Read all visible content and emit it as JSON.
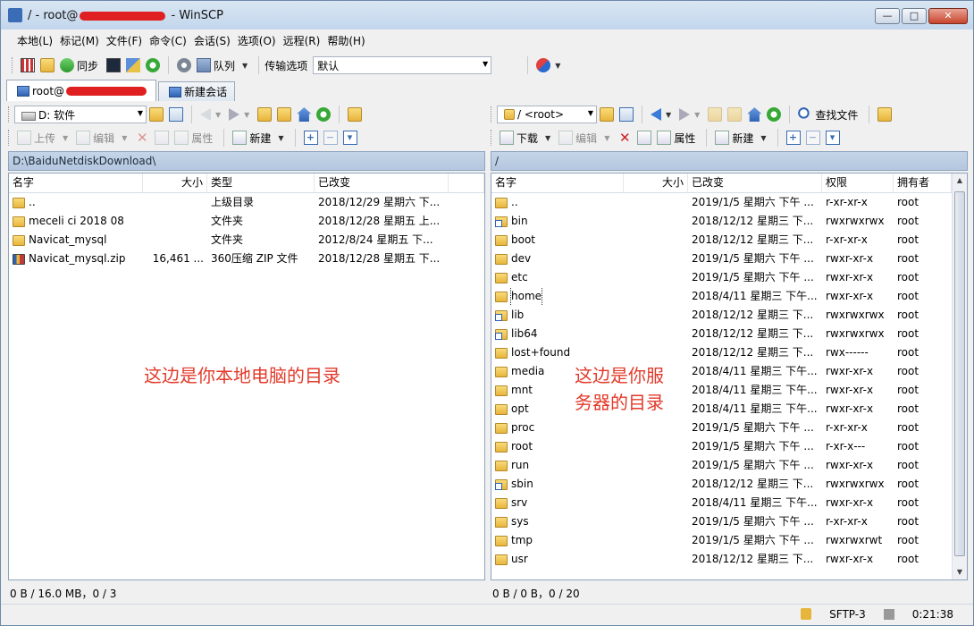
{
  "window": {
    "title_prefix": "/ - root@",
    "title_suffix": " - WinSCP",
    "min_icon": "—",
    "max_icon": "□",
    "close_icon": "✕"
  },
  "menu": [
    "本地(L)",
    "标记(M)",
    "文件(F)",
    "命令(C)",
    "会话(S)",
    "选项(O)",
    "远程(R)",
    "帮助(H)"
  ],
  "toolbar": {
    "sync_label": "同步",
    "queue_label": "队列",
    "transfer_label": "传输选项",
    "transfer_value": "默认"
  },
  "tabs": {
    "session_label": "root@",
    "new_session_label": "新建会话"
  },
  "left": {
    "drive": "D: 软件",
    "upload_label": "上传",
    "edit_label": "编辑",
    "props_label": "属性",
    "new_label": "新建",
    "path": "D:\\BaiduNetdiskDownload\\",
    "headers": [
      "名字",
      "大小",
      "类型",
      "已改变"
    ],
    "rows": [
      {
        "name": "..",
        "size": "",
        "type": "上级目录",
        "changed": "2018/12/29 星期六  下..."
      },
      {
        "name": "meceli ci 2018 08",
        "size": "",
        "type": "文件夹",
        "changed": "2018/12/28 星期五  上..."
      },
      {
        "name": "Navicat_mysql",
        "size": "",
        "type": "文件夹",
        "changed": "2012/8/24 星期五  下..."
      },
      {
        "name": "Navicat_mysql.zip",
        "size": "16,461 ...",
        "type": "360压缩 ZIP 文件",
        "changed": "2018/12/28 星期五  下..."
      }
    ],
    "annotation": "这边是你本地电脑的目录",
    "status": "0 B / 16.0 MB，0 / 3"
  },
  "right": {
    "location": "/ <root>",
    "download_label": "下载",
    "edit_label": "编辑",
    "props_label": "属性",
    "new_label": "新建",
    "find_label": "查找文件",
    "path": "/",
    "headers": [
      "名字",
      "大小",
      "已改变",
      "权限",
      "拥有者"
    ],
    "rows": [
      {
        "name": "..",
        "changed": "2019/1/5 星期六 下午 ...",
        "perm": "r-xr-xr-x",
        "owner": "root",
        "kind": "up"
      },
      {
        "name": "bin",
        "changed": "2018/12/12 星期三 下...",
        "perm": "rwxrwxrwx",
        "owner": "root",
        "kind": "link"
      },
      {
        "name": "boot",
        "changed": "2018/12/12 星期三 下...",
        "perm": "r-xr-xr-x",
        "owner": "root",
        "kind": "dir"
      },
      {
        "name": "dev",
        "changed": "2019/1/5 星期六 下午 ...",
        "perm": "rwxr-xr-x",
        "owner": "root",
        "kind": "dir"
      },
      {
        "name": "etc",
        "changed": "2019/1/5 星期六 下午 ...",
        "perm": "rwxr-xr-x",
        "owner": "root",
        "kind": "dir"
      },
      {
        "name": "home",
        "changed": "2018/4/11 星期三 下午...",
        "perm": "rwxr-xr-x",
        "owner": "root",
        "kind": "dir"
      },
      {
        "name": "lib",
        "changed": "2018/12/12 星期三 下...",
        "perm": "rwxrwxrwx",
        "owner": "root",
        "kind": "link"
      },
      {
        "name": "lib64",
        "changed": "2018/12/12 星期三 下...",
        "perm": "rwxrwxrwx",
        "owner": "root",
        "kind": "link"
      },
      {
        "name": "lost+found",
        "changed": "2018/12/12 星期三 下...",
        "perm": "rwx------",
        "owner": "root",
        "kind": "dir"
      },
      {
        "name": "media",
        "changed": "2018/4/11 星期三 下午...",
        "perm": "rwxr-xr-x",
        "owner": "root",
        "kind": "dir"
      },
      {
        "name": "mnt",
        "changed": "2018/4/11 星期三 下午...",
        "perm": "rwxr-xr-x",
        "owner": "root",
        "kind": "dir"
      },
      {
        "name": "opt",
        "changed": "2018/4/11 星期三 下午...",
        "perm": "rwxr-xr-x",
        "owner": "root",
        "kind": "dir"
      },
      {
        "name": "proc",
        "changed": "2019/1/5 星期六 下午 ...",
        "perm": "r-xr-xr-x",
        "owner": "root",
        "kind": "dir"
      },
      {
        "name": "root",
        "changed": "2019/1/5 星期六 下午 ...",
        "perm": "r-xr-x---",
        "owner": "root",
        "kind": "dir"
      },
      {
        "name": "run",
        "changed": "2019/1/5 星期六 下午 ...",
        "perm": "rwxr-xr-x",
        "owner": "root",
        "kind": "dir"
      },
      {
        "name": "sbin",
        "changed": "2018/12/12 星期三 下...",
        "perm": "rwxrwxrwx",
        "owner": "root",
        "kind": "link"
      },
      {
        "name": "srv",
        "changed": "2018/4/11 星期三 下午...",
        "perm": "rwxr-xr-x",
        "owner": "root",
        "kind": "dir"
      },
      {
        "name": "sys",
        "changed": "2019/1/5 星期六 下午 ...",
        "perm": "r-xr-xr-x",
        "owner": "root",
        "kind": "dir"
      },
      {
        "name": "tmp",
        "changed": "2019/1/5 星期六 下午 ...",
        "perm": "rwxrwxrwt",
        "owner": "root",
        "kind": "dir"
      },
      {
        "name": "usr",
        "changed": "2018/12/12 星期三 下...",
        "perm": "rwxr-xr-x",
        "owner": "root",
        "kind": "dir"
      }
    ],
    "annotation_line1": "这边是你服",
    "annotation_line2": "务器的目录",
    "status": "0 B / 0 B，0 / 20"
  },
  "statusbar": {
    "protocol": "SFTP-3",
    "time": "0:21:38"
  }
}
